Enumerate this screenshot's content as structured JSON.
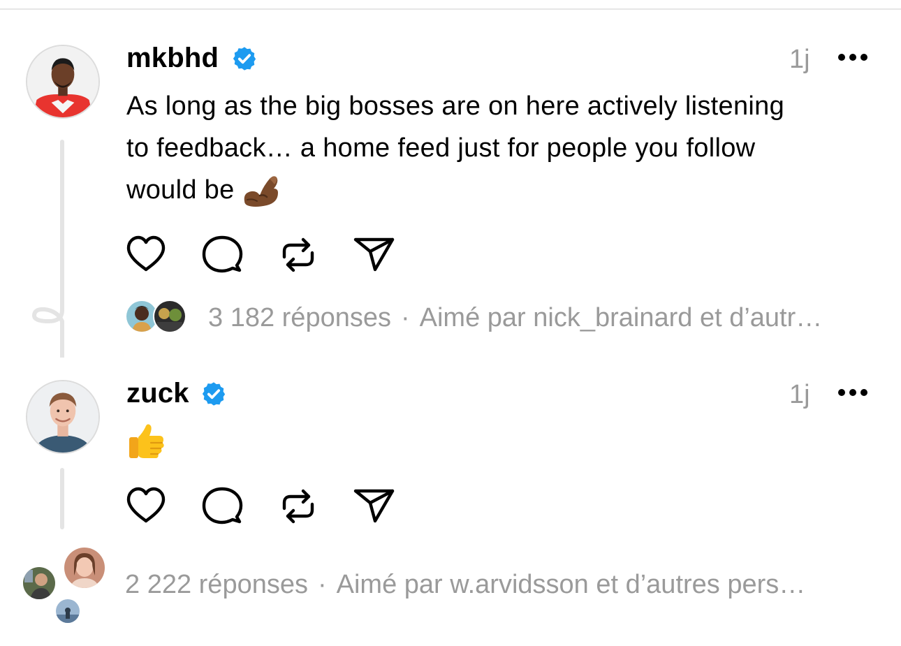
{
  "posts": [
    {
      "username": "mkbhd",
      "timestamp": "1j",
      "text_lines": [
        "As long as the big bosses are on here actively listening",
        "to feedback… a home feed just for people you follow",
        "would be"
      ],
      "inline_emoji": "pinching-hand-emoji",
      "replies_count": "3 182 réponses",
      "separator": "·",
      "liked_by": "Aimé par nick_brainard et d’autr…"
    },
    {
      "username": "zuck",
      "timestamp": "1j",
      "emoji": "thumbs-up-emoji",
      "replies_count": "2 222 réponses",
      "separator": "·",
      "liked_by": "Aimé par w.arvidsson et d’autres pers…"
    }
  ],
  "icons": {
    "verified": "verified-badge-icon",
    "more": "more-icon",
    "like": "heart-icon",
    "reply": "comment-bubble-icon",
    "repost": "repost-icon",
    "share": "send-icon"
  },
  "colors": {
    "verified_blue": "#1D9BF0",
    "meta_gray": "#9a9a9a",
    "thread_line": "#e4e4e4"
  }
}
